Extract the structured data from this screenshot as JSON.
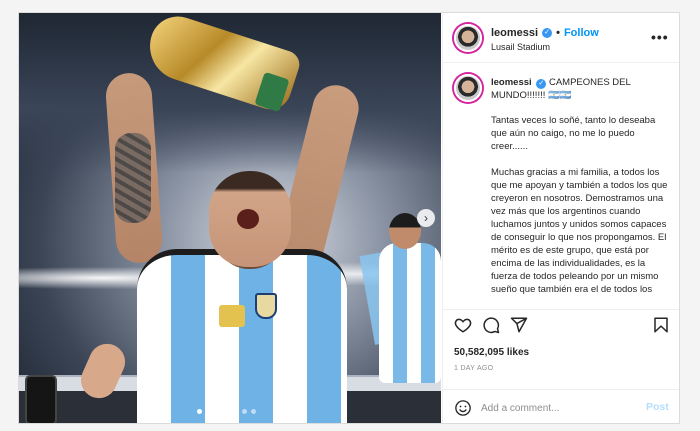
{
  "post": {
    "username": "leomessi",
    "follow_label": "Follow",
    "separator": "•",
    "location": "Lusail Stadium",
    "more_label": "•••",
    "verified_mark": "✓",
    "caption_head": "CAMPEONES DEL MUNDO!!!!!!! 🇦🇷🇦🇷",
    "caption_paragraphs": [
      "Tantas veces lo soñé, tanto lo deseaba que aún no caigo, no me lo puedo creer......",
      "Muchas gracias a mi familia, a todos los que me apoyan y también a todos los que creyeron en nosotros. Demostramos una vez más que los argentinos cuando luchamos juntos y unidos somos capaces de conseguir lo que nos propongamos. El mérito es de este grupo, que está por encima de las individualidades, es la fuerza de todos peleando por un mismo sueño que también era el de todos los"
    ],
    "likes": "50,582,095 likes",
    "time_ago": "1 DAY AGO",
    "comment_placeholder": "Add a comment...",
    "post_label": "Post",
    "next_label": "›"
  },
  "icons": [
    "heart-icon",
    "comment-icon",
    "share-icon",
    "bookmark-icon",
    "emoji-icon",
    "verified-icon",
    "more-icon",
    "chevron-right-icon"
  ],
  "colors": {
    "accent": "#0095f6",
    "verified": "#3897f0",
    "post_disabled": "#b2dffc",
    "muted": "#8e8e8e"
  }
}
